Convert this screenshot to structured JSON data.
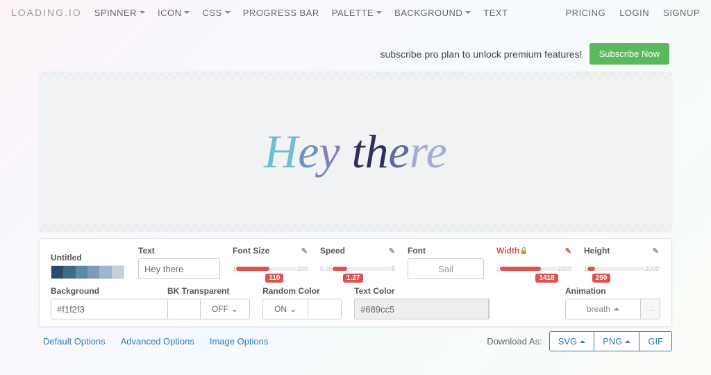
{
  "brand": "LOADING.IO",
  "nav": {
    "left": [
      "SPINNER",
      "ICON",
      "CSS",
      "PROGRESS BAR",
      "PALETTE",
      "BACKGROUND",
      "TEXT"
    ],
    "right": [
      "PRICING",
      "LOGIN",
      "SIGNUP"
    ]
  },
  "banner": {
    "text": "subscribe pro plan to unlock premium features!",
    "button": "Subscribe Now"
  },
  "canvas": {
    "text": "Hey there"
  },
  "panel": {
    "title_label": "Untitled",
    "palette": [
      "#2b4a66",
      "#3e6a8c",
      "#5a8aa6",
      "#7b9cb8",
      "#a0b4cc",
      "#c7cfdf"
    ],
    "text": {
      "label": "Text",
      "value": "Hey there"
    },
    "font_size": {
      "label": "Font Size",
      "min": "1",
      "max": "200",
      "value": "110",
      "fill_pct": 55
    },
    "speed": {
      "label": "Speed",
      "min": "0.05",
      "max": "5",
      "value": "1.27",
      "fill_pct": 25
    },
    "font": {
      "label": "Font",
      "value": "Sail"
    },
    "width": {
      "label": "Width",
      "locked": true,
      "min": "1",
      "max": "2000",
      "value": "1418",
      "fill_pct": 71
    },
    "height": {
      "label": "Height",
      "min": "1",
      "max": "2000",
      "value": "250",
      "fill_pct": 13
    },
    "background": {
      "label": "Background",
      "value": "#f1f2f3"
    },
    "bk_transparent": {
      "label": "BK Transparent",
      "value": "OFF"
    },
    "random_color": {
      "label": "Random Color",
      "value": "ON",
      "swatch": "#ffffff"
    },
    "text_color": {
      "label": "Text Color",
      "value": "#689cc5"
    },
    "animation": {
      "label": "Animation",
      "value": "breath"
    }
  },
  "footer": {
    "options": [
      "Default Options",
      "Advanced Options",
      "Image Options"
    ],
    "download_label": "Download As:",
    "formats": [
      "SVG",
      "PNG",
      "GIF"
    ]
  }
}
